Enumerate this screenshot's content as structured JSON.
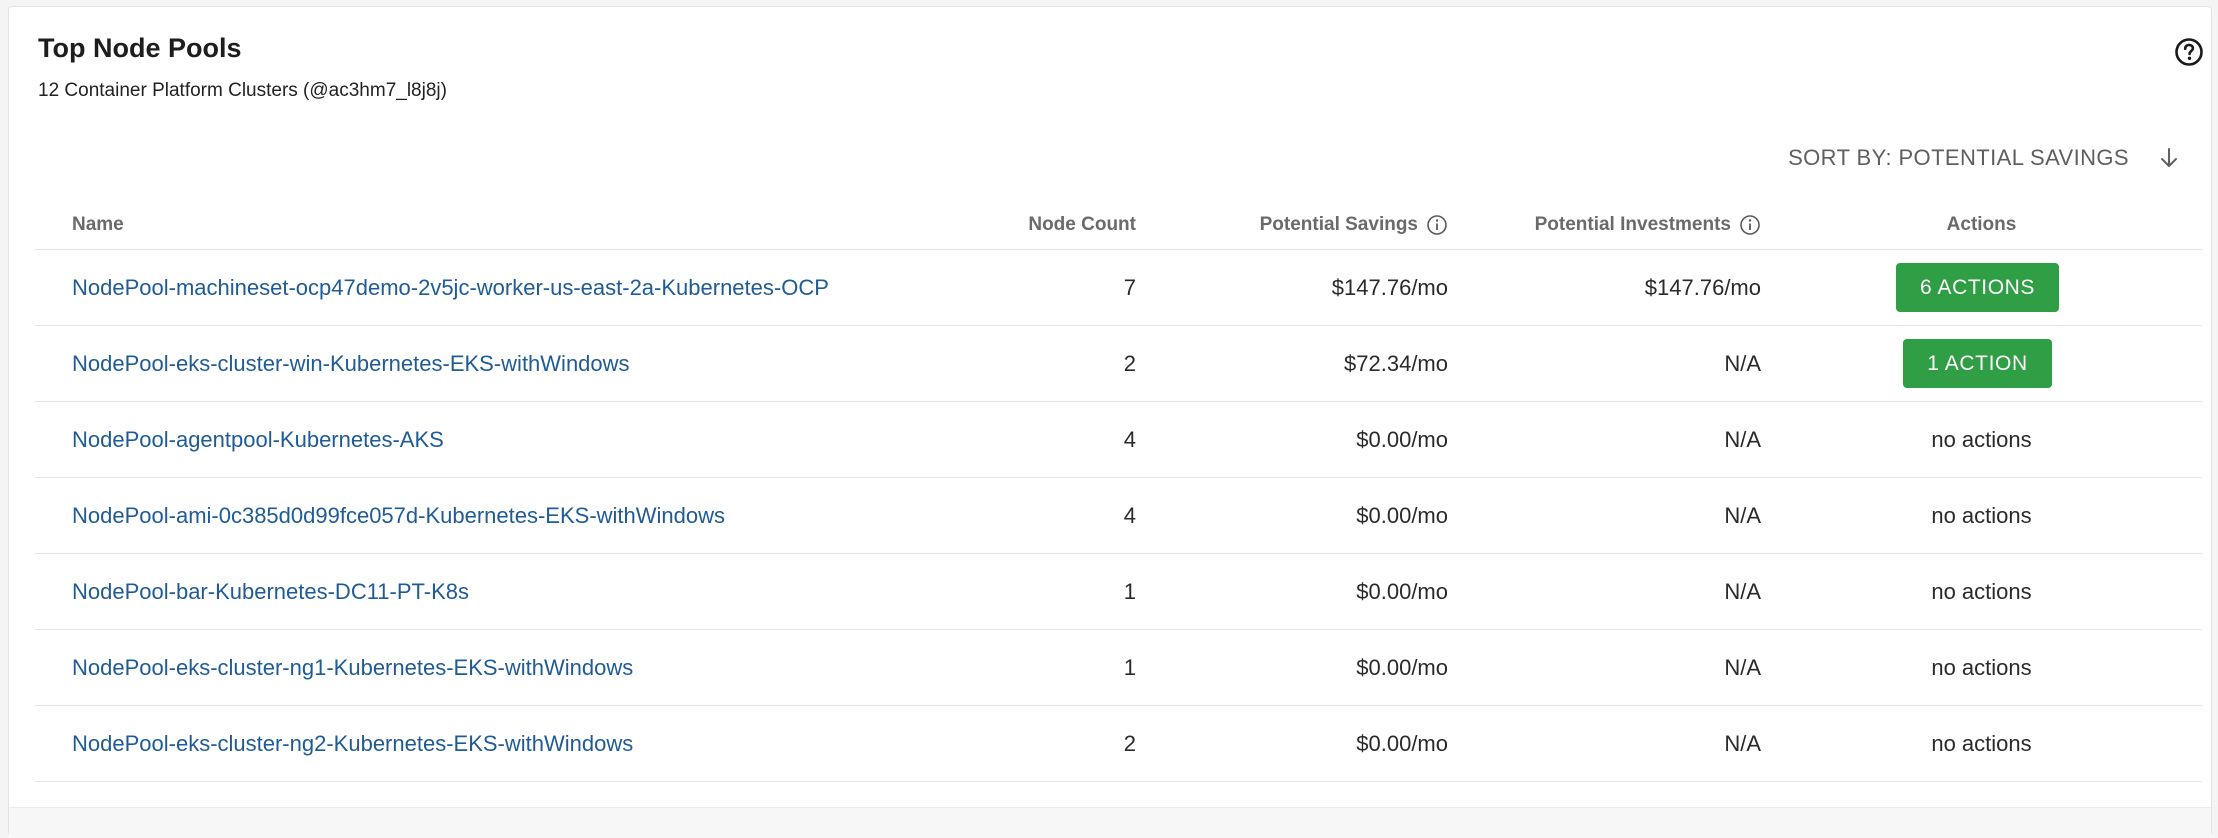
{
  "header": {
    "title": "Top Node Pools",
    "subtitle": "12 Container Platform Clusters (@ac3hm7_l8j8j)"
  },
  "sort": {
    "label": "SORT BY: POTENTIAL SAVINGS",
    "direction_icon": "arrow-down-icon"
  },
  "columns": {
    "name": "Name",
    "node_count": "Node Count",
    "potential_savings": "Potential Savings",
    "potential_investments": "Potential Investments",
    "actions": "Actions"
  },
  "rows": [
    {
      "name": "NodePool-machineset-ocp47demo-2v5jc-worker-us-east-2a-Kubernetes-OCP",
      "node_count": "7",
      "potential_savings": "$147.76/mo",
      "potential_investments": "$147.76/mo",
      "actions": "6 ACTIONS",
      "has_actions": true
    },
    {
      "name": "NodePool-eks-cluster-win-Kubernetes-EKS-withWindows",
      "node_count": "2",
      "potential_savings": "$72.34/mo",
      "potential_investments": "N/A",
      "actions": "1 ACTION",
      "has_actions": true
    },
    {
      "name": "NodePool-agentpool-Kubernetes-AKS",
      "node_count": "4",
      "potential_savings": "$0.00/mo",
      "potential_investments": "N/A",
      "actions": "no actions",
      "has_actions": false
    },
    {
      "name": "NodePool-ami-0c385d0d99fce057d-Kubernetes-EKS-withWindows",
      "node_count": "4",
      "potential_savings": "$0.00/mo",
      "potential_investments": "N/A",
      "actions": "no actions",
      "has_actions": false
    },
    {
      "name": "NodePool-bar-Kubernetes-DC11-PT-K8s",
      "node_count": "1",
      "potential_savings": "$0.00/mo",
      "potential_investments": "N/A",
      "actions": "no actions",
      "has_actions": false
    },
    {
      "name": "NodePool-eks-cluster-ng1-Kubernetes-EKS-withWindows",
      "node_count": "1",
      "potential_savings": "$0.00/mo",
      "potential_investments": "N/A",
      "actions": "no actions",
      "has_actions": false
    },
    {
      "name": "NodePool-eks-cluster-ng2-Kubernetes-EKS-withWindows",
      "node_count": "2",
      "potential_savings": "$0.00/mo",
      "potential_investments": "N/A",
      "actions": "no actions",
      "has_actions": false
    }
  ],
  "colors": {
    "link": "#1f5b96",
    "action_button": "#2f9e44"
  },
  "icons": {
    "help": "help-circle-icon",
    "info": "info-icon",
    "sort": "arrow-down-icon"
  }
}
